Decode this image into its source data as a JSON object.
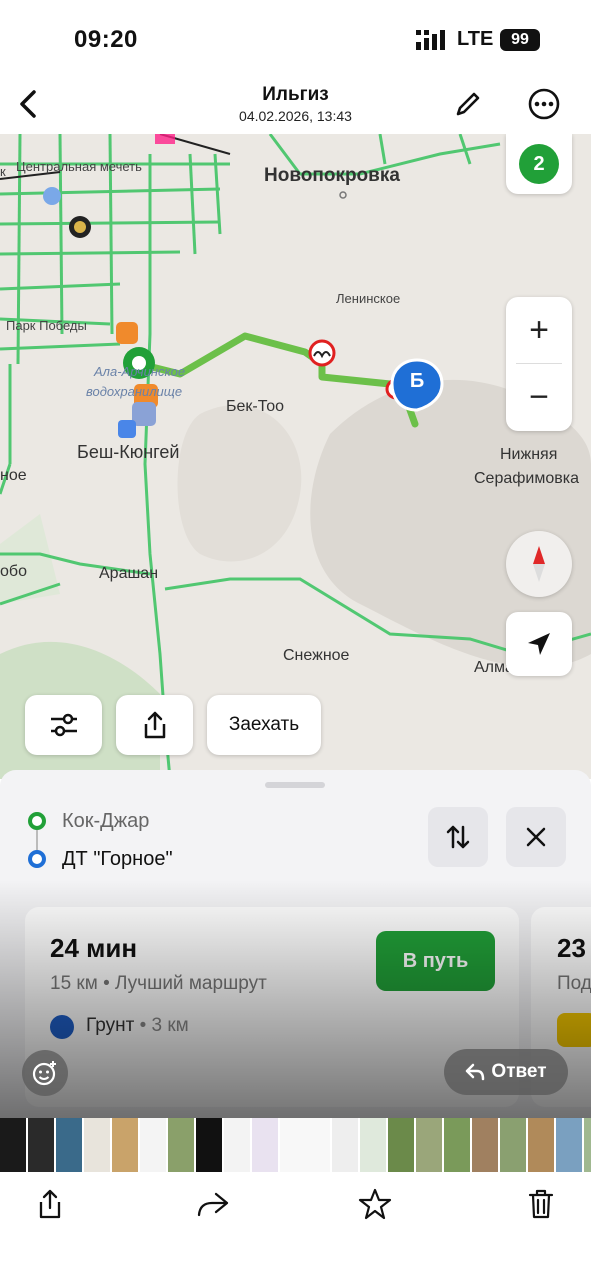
{
  "status_bar": {
    "time": "09:20",
    "network": "LTE",
    "battery": "99"
  },
  "header": {
    "title": "Ильгиз",
    "subtitle": "04.02.2026, 13:43"
  },
  "map": {
    "labels": {
      "novopokrovka": "Новопокровка",
      "mosque": "Центральная мечеть",
      "park": "Парк Победы",
      "reservoir": "Алаарчинское водохранилище",
      "reservoir_line1": "Ала-Арчинское",
      "reservoir_line2": "водохранилище",
      "leninskoe": "Ленинское",
      "bek_too": "Бек-Тоо",
      "besh_kungey": "Беш-Кюнгей",
      "nizhnyaya": "Нижняя",
      "serafimovka": "Серафимовка",
      "arashan": "Арашан",
      "snezhnoe": "Снежное",
      "almaluu": "Алмалуу",
      "left_noe": "ное",
      "left_obo": "обо",
      "k": "к"
    },
    "destination_marker": "Б",
    "layers_badge": "2",
    "zoom_in": "+",
    "zoom_out": "−",
    "enter_button": "Заехать"
  },
  "route": {
    "from": "Кок-Джар",
    "to": "ДТ \"Горное\"",
    "primary": {
      "duration": "24 мин",
      "meta": "15 км • Лучший маршрут",
      "go_label": "В путь",
      "surface": "Грунт",
      "surface_distance": "• 3 км"
    },
    "secondary": {
      "duration": "23",
      "meta": "Под"
    }
  },
  "viewer": {
    "reply_label": "Ответ"
  },
  "colors": {
    "accent_green": "#21a038",
    "route_green": "#6cc04a",
    "pin_blue": "#1f6fd6",
    "road_green": "#49c66b"
  }
}
